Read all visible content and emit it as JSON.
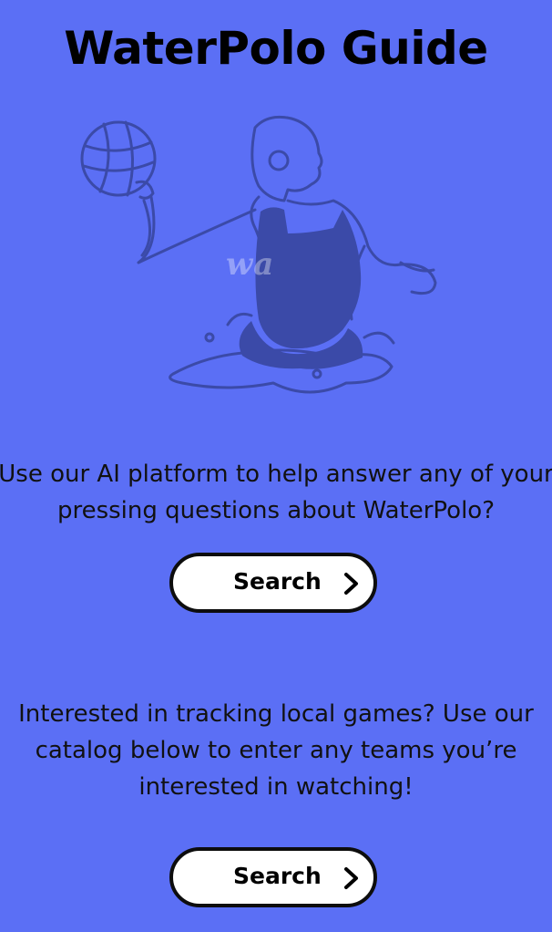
{
  "page": {
    "title": "WaterPolo Guide",
    "background_color": "#5b6ff5"
  },
  "hero": {
    "image": "water-polo-player-illustration",
    "watermark": "wa"
  },
  "ai_section": {
    "text": "Use our AI platform to help answer any of your pressing questions about WaterPolo?",
    "button_label": "Search",
    "button_icon": "chevron-right-icon"
  },
  "catalog_section": {
    "text": "Interested in tracking local games?  Use our catalog below to enter any teams you’re interested in watching!",
    "button_label": "Search",
    "button_icon": "chevron-right-icon"
  }
}
